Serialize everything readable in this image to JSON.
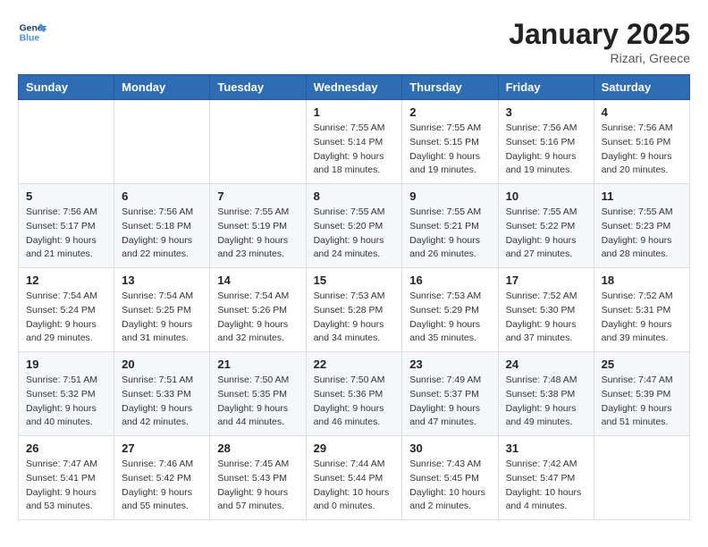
{
  "header": {
    "logo_line1": "General",
    "logo_line2": "Blue",
    "month": "January 2025",
    "location": "Rizari, Greece"
  },
  "weekdays": [
    "Sunday",
    "Monday",
    "Tuesday",
    "Wednesday",
    "Thursday",
    "Friday",
    "Saturday"
  ],
  "weeks": [
    [
      {
        "day": "",
        "info": ""
      },
      {
        "day": "",
        "info": ""
      },
      {
        "day": "",
        "info": ""
      },
      {
        "day": "1",
        "info": "Sunrise: 7:55 AM\nSunset: 5:14 PM\nDaylight: 9 hours\nand 18 minutes."
      },
      {
        "day": "2",
        "info": "Sunrise: 7:55 AM\nSunset: 5:15 PM\nDaylight: 9 hours\nand 19 minutes."
      },
      {
        "day": "3",
        "info": "Sunrise: 7:56 AM\nSunset: 5:16 PM\nDaylight: 9 hours\nand 19 minutes."
      },
      {
        "day": "4",
        "info": "Sunrise: 7:56 AM\nSunset: 5:16 PM\nDaylight: 9 hours\nand 20 minutes."
      }
    ],
    [
      {
        "day": "5",
        "info": "Sunrise: 7:56 AM\nSunset: 5:17 PM\nDaylight: 9 hours\nand 21 minutes."
      },
      {
        "day": "6",
        "info": "Sunrise: 7:56 AM\nSunset: 5:18 PM\nDaylight: 9 hours\nand 22 minutes."
      },
      {
        "day": "7",
        "info": "Sunrise: 7:55 AM\nSunset: 5:19 PM\nDaylight: 9 hours\nand 23 minutes."
      },
      {
        "day": "8",
        "info": "Sunrise: 7:55 AM\nSunset: 5:20 PM\nDaylight: 9 hours\nand 24 minutes."
      },
      {
        "day": "9",
        "info": "Sunrise: 7:55 AM\nSunset: 5:21 PM\nDaylight: 9 hours\nand 26 minutes."
      },
      {
        "day": "10",
        "info": "Sunrise: 7:55 AM\nSunset: 5:22 PM\nDaylight: 9 hours\nand 27 minutes."
      },
      {
        "day": "11",
        "info": "Sunrise: 7:55 AM\nSunset: 5:23 PM\nDaylight: 9 hours\nand 28 minutes."
      }
    ],
    [
      {
        "day": "12",
        "info": "Sunrise: 7:54 AM\nSunset: 5:24 PM\nDaylight: 9 hours\nand 29 minutes."
      },
      {
        "day": "13",
        "info": "Sunrise: 7:54 AM\nSunset: 5:25 PM\nDaylight: 9 hours\nand 31 minutes."
      },
      {
        "day": "14",
        "info": "Sunrise: 7:54 AM\nSunset: 5:26 PM\nDaylight: 9 hours\nand 32 minutes."
      },
      {
        "day": "15",
        "info": "Sunrise: 7:53 AM\nSunset: 5:28 PM\nDaylight: 9 hours\nand 34 minutes."
      },
      {
        "day": "16",
        "info": "Sunrise: 7:53 AM\nSunset: 5:29 PM\nDaylight: 9 hours\nand 35 minutes."
      },
      {
        "day": "17",
        "info": "Sunrise: 7:52 AM\nSunset: 5:30 PM\nDaylight: 9 hours\nand 37 minutes."
      },
      {
        "day": "18",
        "info": "Sunrise: 7:52 AM\nSunset: 5:31 PM\nDaylight: 9 hours\nand 39 minutes."
      }
    ],
    [
      {
        "day": "19",
        "info": "Sunrise: 7:51 AM\nSunset: 5:32 PM\nDaylight: 9 hours\nand 40 minutes."
      },
      {
        "day": "20",
        "info": "Sunrise: 7:51 AM\nSunset: 5:33 PM\nDaylight: 9 hours\nand 42 minutes."
      },
      {
        "day": "21",
        "info": "Sunrise: 7:50 AM\nSunset: 5:35 PM\nDaylight: 9 hours\nand 44 minutes."
      },
      {
        "day": "22",
        "info": "Sunrise: 7:50 AM\nSunset: 5:36 PM\nDaylight: 9 hours\nand 46 minutes."
      },
      {
        "day": "23",
        "info": "Sunrise: 7:49 AM\nSunset: 5:37 PM\nDaylight: 9 hours\nand 47 minutes."
      },
      {
        "day": "24",
        "info": "Sunrise: 7:48 AM\nSunset: 5:38 PM\nDaylight: 9 hours\nand 49 minutes."
      },
      {
        "day": "25",
        "info": "Sunrise: 7:47 AM\nSunset: 5:39 PM\nDaylight: 9 hours\nand 51 minutes."
      }
    ],
    [
      {
        "day": "26",
        "info": "Sunrise: 7:47 AM\nSunset: 5:41 PM\nDaylight: 9 hours\nand 53 minutes."
      },
      {
        "day": "27",
        "info": "Sunrise: 7:46 AM\nSunset: 5:42 PM\nDaylight: 9 hours\nand 55 minutes."
      },
      {
        "day": "28",
        "info": "Sunrise: 7:45 AM\nSunset: 5:43 PM\nDaylight: 9 hours\nand 57 minutes."
      },
      {
        "day": "29",
        "info": "Sunrise: 7:44 AM\nSunset: 5:44 PM\nDaylight: 10 hours\nand 0 minutes."
      },
      {
        "day": "30",
        "info": "Sunrise: 7:43 AM\nSunset: 5:45 PM\nDaylight: 10 hours\nand 2 minutes."
      },
      {
        "day": "31",
        "info": "Sunrise: 7:42 AM\nSunset: 5:47 PM\nDaylight: 10 hours\nand 4 minutes."
      },
      {
        "day": "",
        "info": ""
      }
    ]
  ]
}
